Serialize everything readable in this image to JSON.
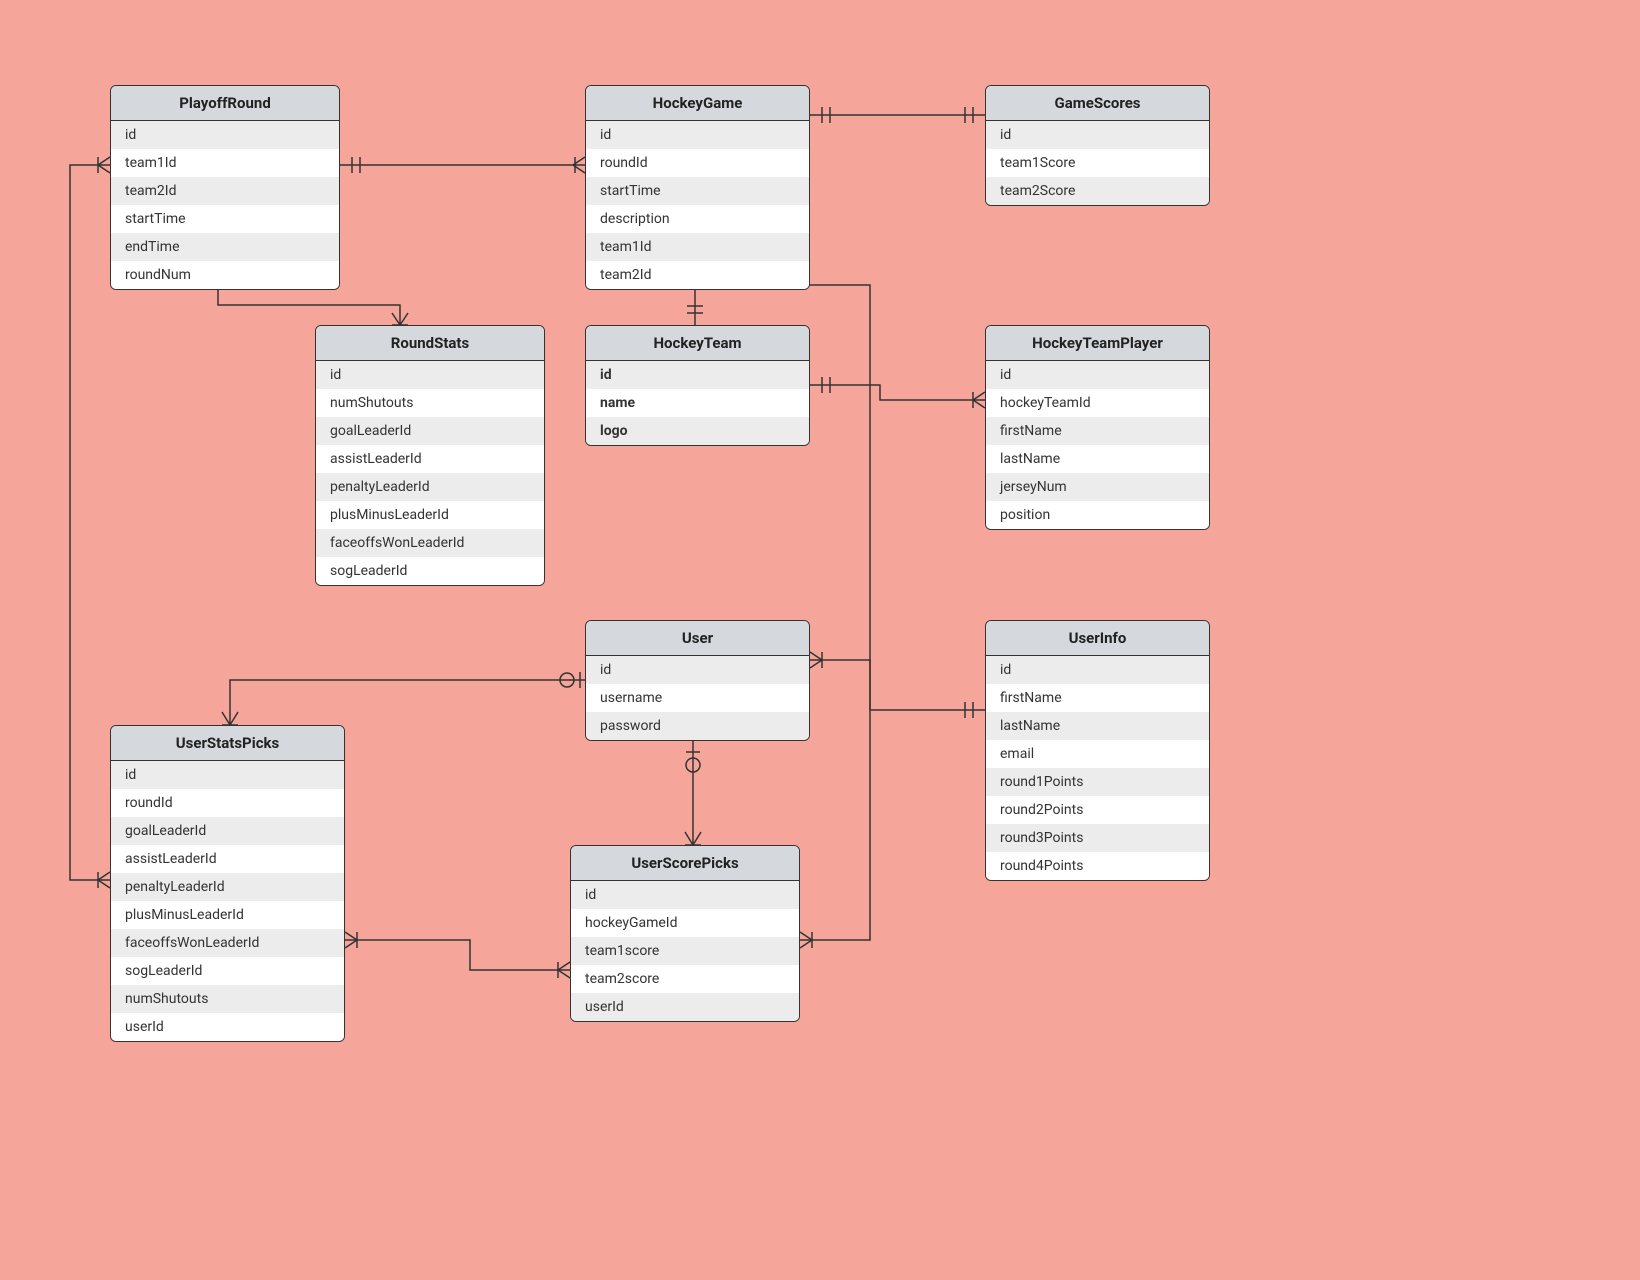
{
  "entities": {
    "playoffRound": {
      "title": "PlayoffRound",
      "attrs": [
        "id",
        "team1Id",
        "team2Id",
        "startTime",
        "endTime",
        "roundNum"
      ]
    },
    "hockeyGame": {
      "title": "HockeyGame",
      "attrs": [
        "id",
        "roundId",
        "startTime",
        "description",
        "team1Id",
        "team2Id"
      ]
    },
    "gameScores": {
      "title": "GameScores",
      "attrs": [
        "id",
        "team1Score",
        "team2Score"
      ]
    },
    "roundStats": {
      "title": "RoundStats",
      "attrs": [
        "id",
        "numShutouts",
        "goalLeaderId",
        "assistLeaderId",
        "penaltyLeaderId",
        "plusMinusLeaderId",
        "faceoffsWonLeaderId",
        "sogLeaderId"
      ]
    },
    "hockeyTeam": {
      "title": "HockeyTeam",
      "attrs": [
        "id",
        "name",
        "logo"
      ]
    },
    "hockeyTeamPlayer": {
      "title": "HockeyTeamPlayer",
      "attrs": [
        "id",
        "hockeyTeamId",
        "firstName",
        "lastName",
        "jerseyNum",
        "position"
      ]
    },
    "user": {
      "title": "User",
      "attrs": [
        "id",
        "username",
        "password"
      ]
    },
    "userInfo": {
      "title": "UserInfo",
      "attrs": [
        "id",
        "firstName",
        "lastName",
        "email",
        "round1Points",
        "round2Points",
        "round3Points",
        "round4Points"
      ]
    },
    "userStatsPicks": {
      "title": "UserStatsPicks",
      "attrs": [
        "id",
        "roundId",
        "goalLeaderId",
        "assistLeaderId",
        "penaltyLeaderId",
        "plusMinusLeaderId",
        "faceoffsWonLeaderId",
        "sogLeaderId",
        "numShutouts",
        "userId"
      ]
    },
    "userScorePicks": {
      "title": "UserScorePicks",
      "attrs": [
        "id",
        "hockeyGameId",
        "team1score",
        "team2score",
        "userId"
      ]
    }
  }
}
